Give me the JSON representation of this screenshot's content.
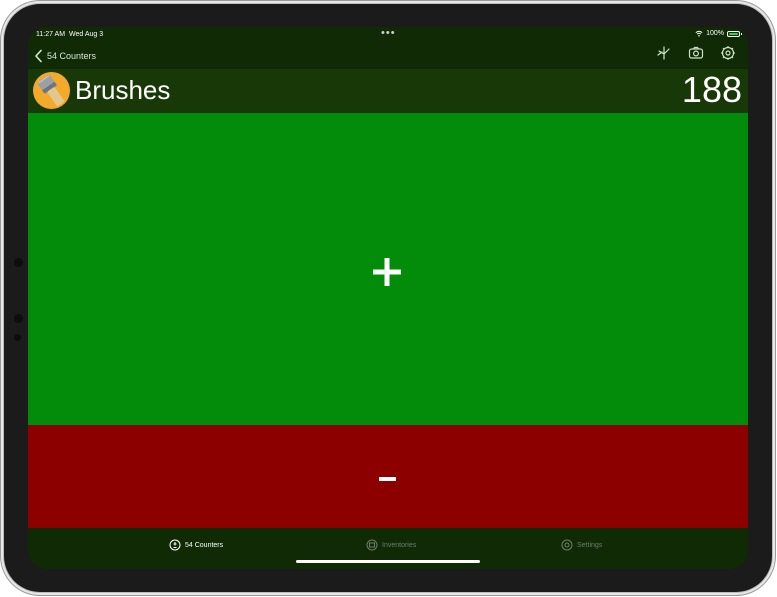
{
  "status_bar": {
    "time": "11:27 AM",
    "date": "Wed Aug 3",
    "battery": "100%",
    "battery_color": "#2fd158"
  },
  "nav": {
    "back_label": "54 Counters",
    "icons": [
      "chart-pin-icon",
      "camera-icon",
      "settings-gear-icon"
    ]
  },
  "counter": {
    "name": "Brushes",
    "value": "188",
    "avatar_icon": "paint-brush-icon"
  },
  "buttons": {
    "increment_icon": "plus-icon",
    "decrement_icon": "minus-icon"
  },
  "tabs": [
    {
      "label": "54 Counters",
      "icon": "counter-icon",
      "active": true
    },
    {
      "label": "Inventories",
      "icon": "inventory-icon",
      "active": false
    },
    {
      "label": "Settings",
      "icon": "gear-icon",
      "active": false
    }
  ],
  "colors": {
    "increment": "#038c09",
    "decrement": "#8c0000",
    "header": "#193807",
    "bar": "#102a06"
  }
}
